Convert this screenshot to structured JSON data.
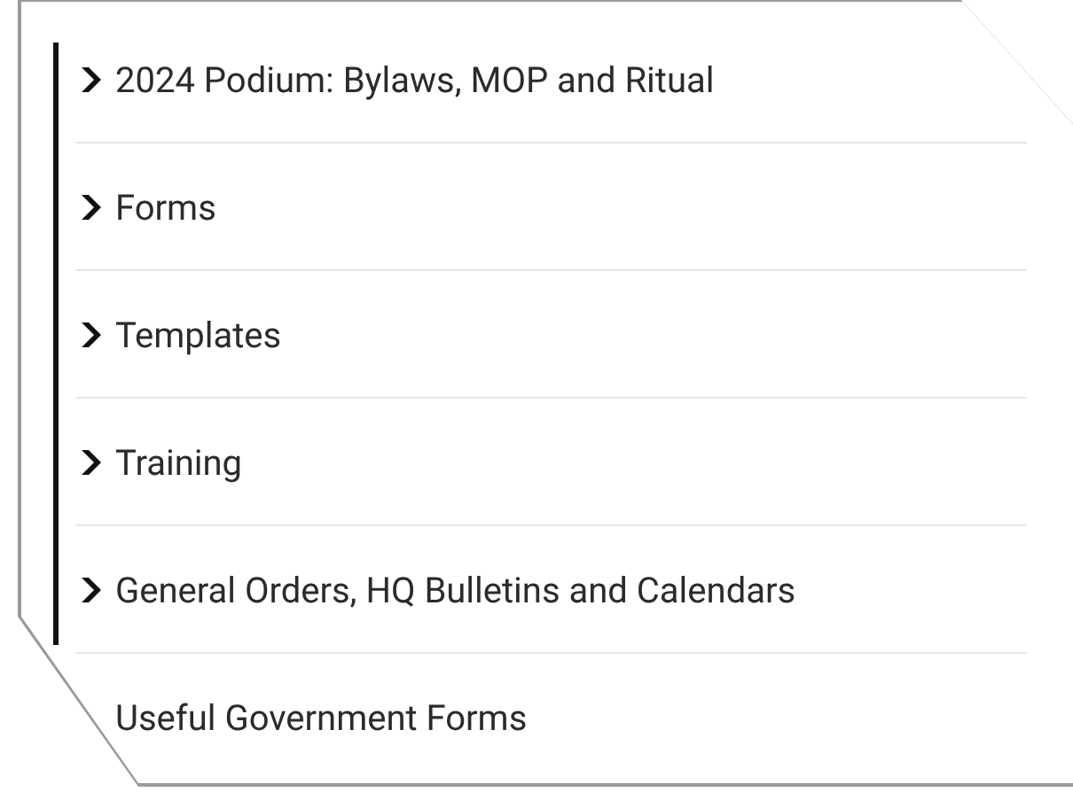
{
  "menu": {
    "items": [
      {
        "label": "2024 Podium: Bylaws, MOP and Ritual",
        "kind": "folder"
      },
      {
        "label": "Forms",
        "kind": "folder"
      },
      {
        "label": "Templates",
        "kind": "folder"
      },
      {
        "label": "Training",
        "kind": "folder"
      },
      {
        "label": "General Orders, HQ Bulletins and Calendars",
        "kind": "folder"
      },
      {
        "label": "Useful Government Forms",
        "kind": "link"
      }
    ]
  }
}
